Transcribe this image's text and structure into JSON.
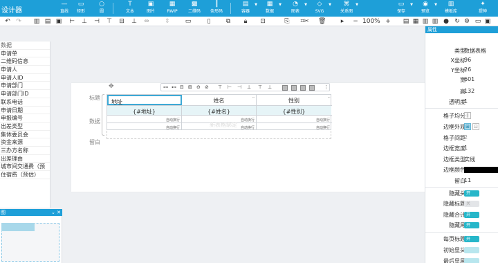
{
  "app": {
    "title": "设计器"
  },
  "toolbar": {
    "items": [
      {
        "label": "直线",
        "icon": "—"
      },
      {
        "label": "矩形",
        "icon": "▭"
      },
      {
        "label": "圆",
        "icon": "○"
      },
      {
        "label": "文本",
        "icon": "T"
      },
      {
        "label": "图片",
        "icon": "▣"
      },
      {
        "label": "RWIP",
        "icon": "▦"
      },
      {
        "label": "二维码",
        "icon": "▩"
      },
      {
        "label": "条形码",
        "icon": "║"
      },
      {
        "label": "容器",
        "icon": "▤"
      },
      {
        "label": "数据",
        "icon": "▦"
      },
      {
        "label": "图表",
        "icon": "◔"
      },
      {
        "label": "SVG",
        "icon": "◇"
      },
      {
        "label": "关系图",
        "icon": "⌘"
      },
      {
        "label": "保存",
        "icon": "▭"
      },
      {
        "label": "预览",
        "icon": "◉"
      },
      {
        "label": "模板库",
        "icon": "▥"
      },
      {
        "label": "提神",
        "icon": "✦"
      }
    ]
  },
  "toolbar2": {
    "zoom": "100%",
    "undo": "↶",
    "redo": "↷",
    "zoom_out": "−",
    "zoom_in": "+"
  },
  "left_panel": {
    "root_label": "数据",
    "items": [
      "申请单",
      "二维码信息",
      "申请人",
      "申请人ID",
      "申请部门",
      "申请部门ID",
      "联系电话",
      "申请日期",
      "申报编号",
      "出差类型",
      "集体委员会",
      "资金来源",
      "三办方名称",
      "出差理由",
      "城市间交通费（预",
      "住宿费（预估）"
    ]
  },
  "thumbnail_panel": {
    "title": "图",
    "collapse": "⌄",
    "close": "✕"
  },
  "canvas": {
    "band_labels": {
      "title": "标题",
      "data": "数据",
      "footer": "留白"
    },
    "table": {
      "header_row": [
        "地址",
        "姓名",
        "性别"
      ],
      "data_row": [
        "{#地址}",
        "{#姓名}",
        "{#性别}"
      ],
      "auto_wrap": "自动换行",
      "hint": "新表格绑定"
    }
  },
  "right_panel": {
    "title": "属性",
    "props": [
      {
        "k": "类型",
        "v": "数据表格"
      },
      {
        "k": "X坐标",
        "v": "96"
      },
      {
        "k": "Y坐标",
        "v": "26"
      },
      {
        "k": "宽",
        "v": "601"
      },
      {
        "k": "高",
        "v": "132"
      },
      {
        "k": "透明度",
        "v": "1"
      }
    ],
    "props2": [
      {
        "k": "格子均分",
        "v": ""
      },
      {
        "k": "边框外观",
        "v": ""
      },
      {
        "k": "格子间距",
        "v": "2"
      },
      {
        "k": "边框宽度",
        "v": "1"
      },
      {
        "k": "边框类型",
        "v": "实线"
      },
      {
        "k": "边框颜色",
        "v": ""
      },
      {
        "k": "留白",
        "v": "11"
      }
    ],
    "toggles": [
      {
        "k": "隐藏头",
        "state": "开"
      },
      {
        "k": "隐藏标题",
        "state": "关"
      },
      {
        "k": "隐藏合计",
        "state": "开"
      },
      {
        "k": "隐藏尾",
        "state": "开"
      },
      {
        "k": "每页标题",
        "state": "开"
      },
      {
        "k": "初始显头",
        "state": ""
      },
      {
        "k": "最后显尾",
        "state": ""
      }
    ],
    "border_color": "#000000",
    "accent": "#1e9fd8"
  }
}
